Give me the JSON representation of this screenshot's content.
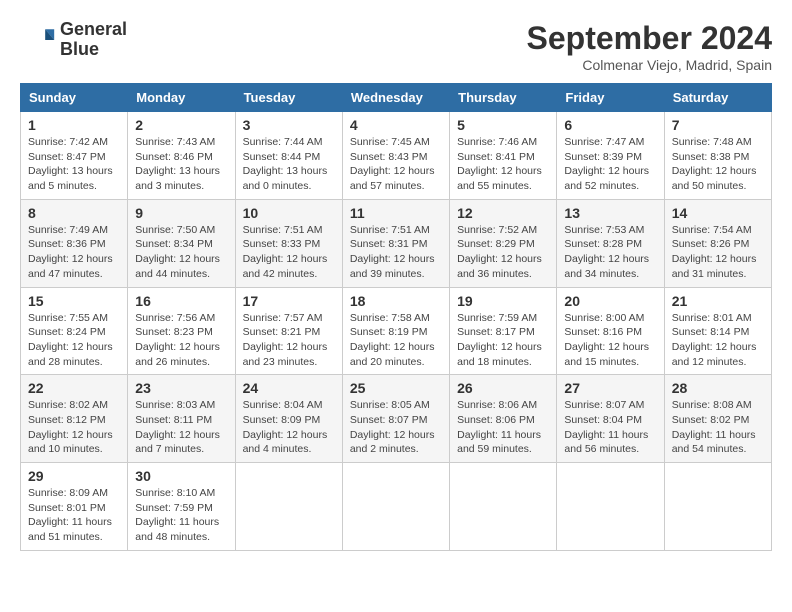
{
  "header": {
    "logo_line1": "General",
    "logo_line2": "Blue",
    "month": "September 2024",
    "location": "Colmenar Viejo, Madrid, Spain"
  },
  "weekdays": [
    "Sunday",
    "Monday",
    "Tuesday",
    "Wednesday",
    "Thursday",
    "Friday",
    "Saturday"
  ],
  "weeks": [
    [
      {
        "day": "1",
        "info": "Sunrise: 7:42 AM\nSunset: 8:47 PM\nDaylight: 13 hours\nand 5 minutes."
      },
      {
        "day": "2",
        "info": "Sunrise: 7:43 AM\nSunset: 8:46 PM\nDaylight: 13 hours\nand 3 minutes."
      },
      {
        "day": "3",
        "info": "Sunrise: 7:44 AM\nSunset: 8:44 PM\nDaylight: 13 hours\nand 0 minutes."
      },
      {
        "day": "4",
        "info": "Sunrise: 7:45 AM\nSunset: 8:43 PM\nDaylight: 12 hours\nand 57 minutes."
      },
      {
        "day": "5",
        "info": "Sunrise: 7:46 AM\nSunset: 8:41 PM\nDaylight: 12 hours\nand 55 minutes."
      },
      {
        "day": "6",
        "info": "Sunrise: 7:47 AM\nSunset: 8:39 PM\nDaylight: 12 hours\nand 52 minutes."
      },
      {
        "day": "7",
        "info": "Sunrise: 7:48 AM\nSunset: 8:38 PM\nDaylight: 12 hours\nand 50 minutes."
      }
    ],
    [
      {
        "day": "8",
        "info": "Sunrise: 7:49 AM\nSunset: 8:36 PM\nDaylight: 12 hours\nand 47 minutes."
      },
      {
        "day": "9",
        "info": "Sunrise: 7:50 AM\nSunset: 8:34 PM\nDaylight: 12 hours\nand 44 minutes."
      },
      {
        "day": "10",
        "info": "Sunrise: 7:51 AM\nSunset: 8:33 PM\nDaylight: 12 hours\nand 42 minutes."
      },
      {
        "day": "11",
        "info": "Sunrise: 7:51 AM\nSunset: 8:31 PM\nDaylight: 12 hours\nand 39 minutes."
      },
      {
        "day": "12",
        "info": "Sunrise: 7:52 AM\nSunset: 8:29 PM\nDaylight: 12 hours\nand 36 minutes."
      },
      {
        "day": "13",
        "info": "Sunrise: 7:53 AM\nSunset: 8:28 PM\nDaylight: 12 hours\nand 34 minutes."
      },
      {
        "day": "14",
        "info": "Sunrise: 7:54 AM\nSunset: 8:26 PM\nDaylight: 12 hours\nand 31 minutes."
      }
    ],
    [
      {
        "day": "15",
        "info": "Sunrise: 7:55 AM\nSunset: 8:24 PM\nDaylight: 12 hours\nand 28 minutes."
      },
      {
        "day": "16",
        "info": "Sunrise: 7:56 AM\nSunset: 8:23 PM\nDaylight: 12 hours\nand 26 minutes."
      },
      {
        "day": "17",
        "info": "Sunrise: 7:57 AM\nSunset: 8:21 PM\nDaylight: 12 hours\nand 23 minutes."
      },
      {
        "day": "18",
        "info": "Sunrise: 7:58 AM\nSunset: 8:19 PM\nDaylight: 12 hours\nand 20 minutes."
      },
      {
        "day": "19",
        "info": "Sunrise: 7:59 AM\nSunset: 8:17 PM\nDaylight: 12 hours\nand 18 minutes."
      },
      {
        "day": "20",
        "info": "Sunrise: 8:00 AM\nSunset: 8:16 PM\nDaylight: 12 hours\nand 15 minutes."
      },
      {
        "day": "21",
        "info": "Sunrise: 8:01 AM\nSunset: 8:14 PM\nDaylight: 12 hours\nand 12 minutes."
      }
    ],
    [
      {
        "day": "22",
        "info": "Sunrise: 8:02 AM\nSunset: 8:12 PM\nDaylight: 12 hours\nand 10 minutes."
      },
      {
        "day": "23",
        "info": "Sunrise: 8:03 AM\nSunset: 8:11 PM\nDaylight: 12 hours\nand 7 minutes."
      },
      {
        "day": "24",
        "info": "Sunrise: 8:04 AM\nSunset: 8:09 PM\nDaylight: 12 hours\nand 4 minutes."
      },
      {
        "day": "25",
        "info": "Sunrise: 8:05 AM\nSunset: 8:07 PM\nDaylight: 12 hours\nand 2 minutes."
      },
      {
        "day": "26",
        "info": "Sunrise: 8:06 AM\nSunset: 8:06 PM\nDaylight: 11 hours\nand 59 minutes."
      },
      {
        "day": "27",
        "info": "Sunrise: 8:07 AM\nSunset: 8:04 PM\nDaylight: 11 hours\nand 56 minutes."
      },
      {
        "day": "28",
        "info": "Sunrise: 8:08 AM\nSunset: 8:02 PM\nDaylight: 11 hours\nand 54 minutes."
      }
    ],
    [
      {
        "day": "29",
        "info": "Sunrise: 8:09 AM\nSunset: 8:01 PM\nDaylight: 11 hours\nand 51 minutes."
      },
      {
        "day": "30",
        "info": "Sunrise: 8:10 AM\nSunset: 7:59 PM\nDaylight: 11 hours\nand 48 minutes."
      },
      null,
      null,
      null,
      null,
      null
    ]
  ]
}
